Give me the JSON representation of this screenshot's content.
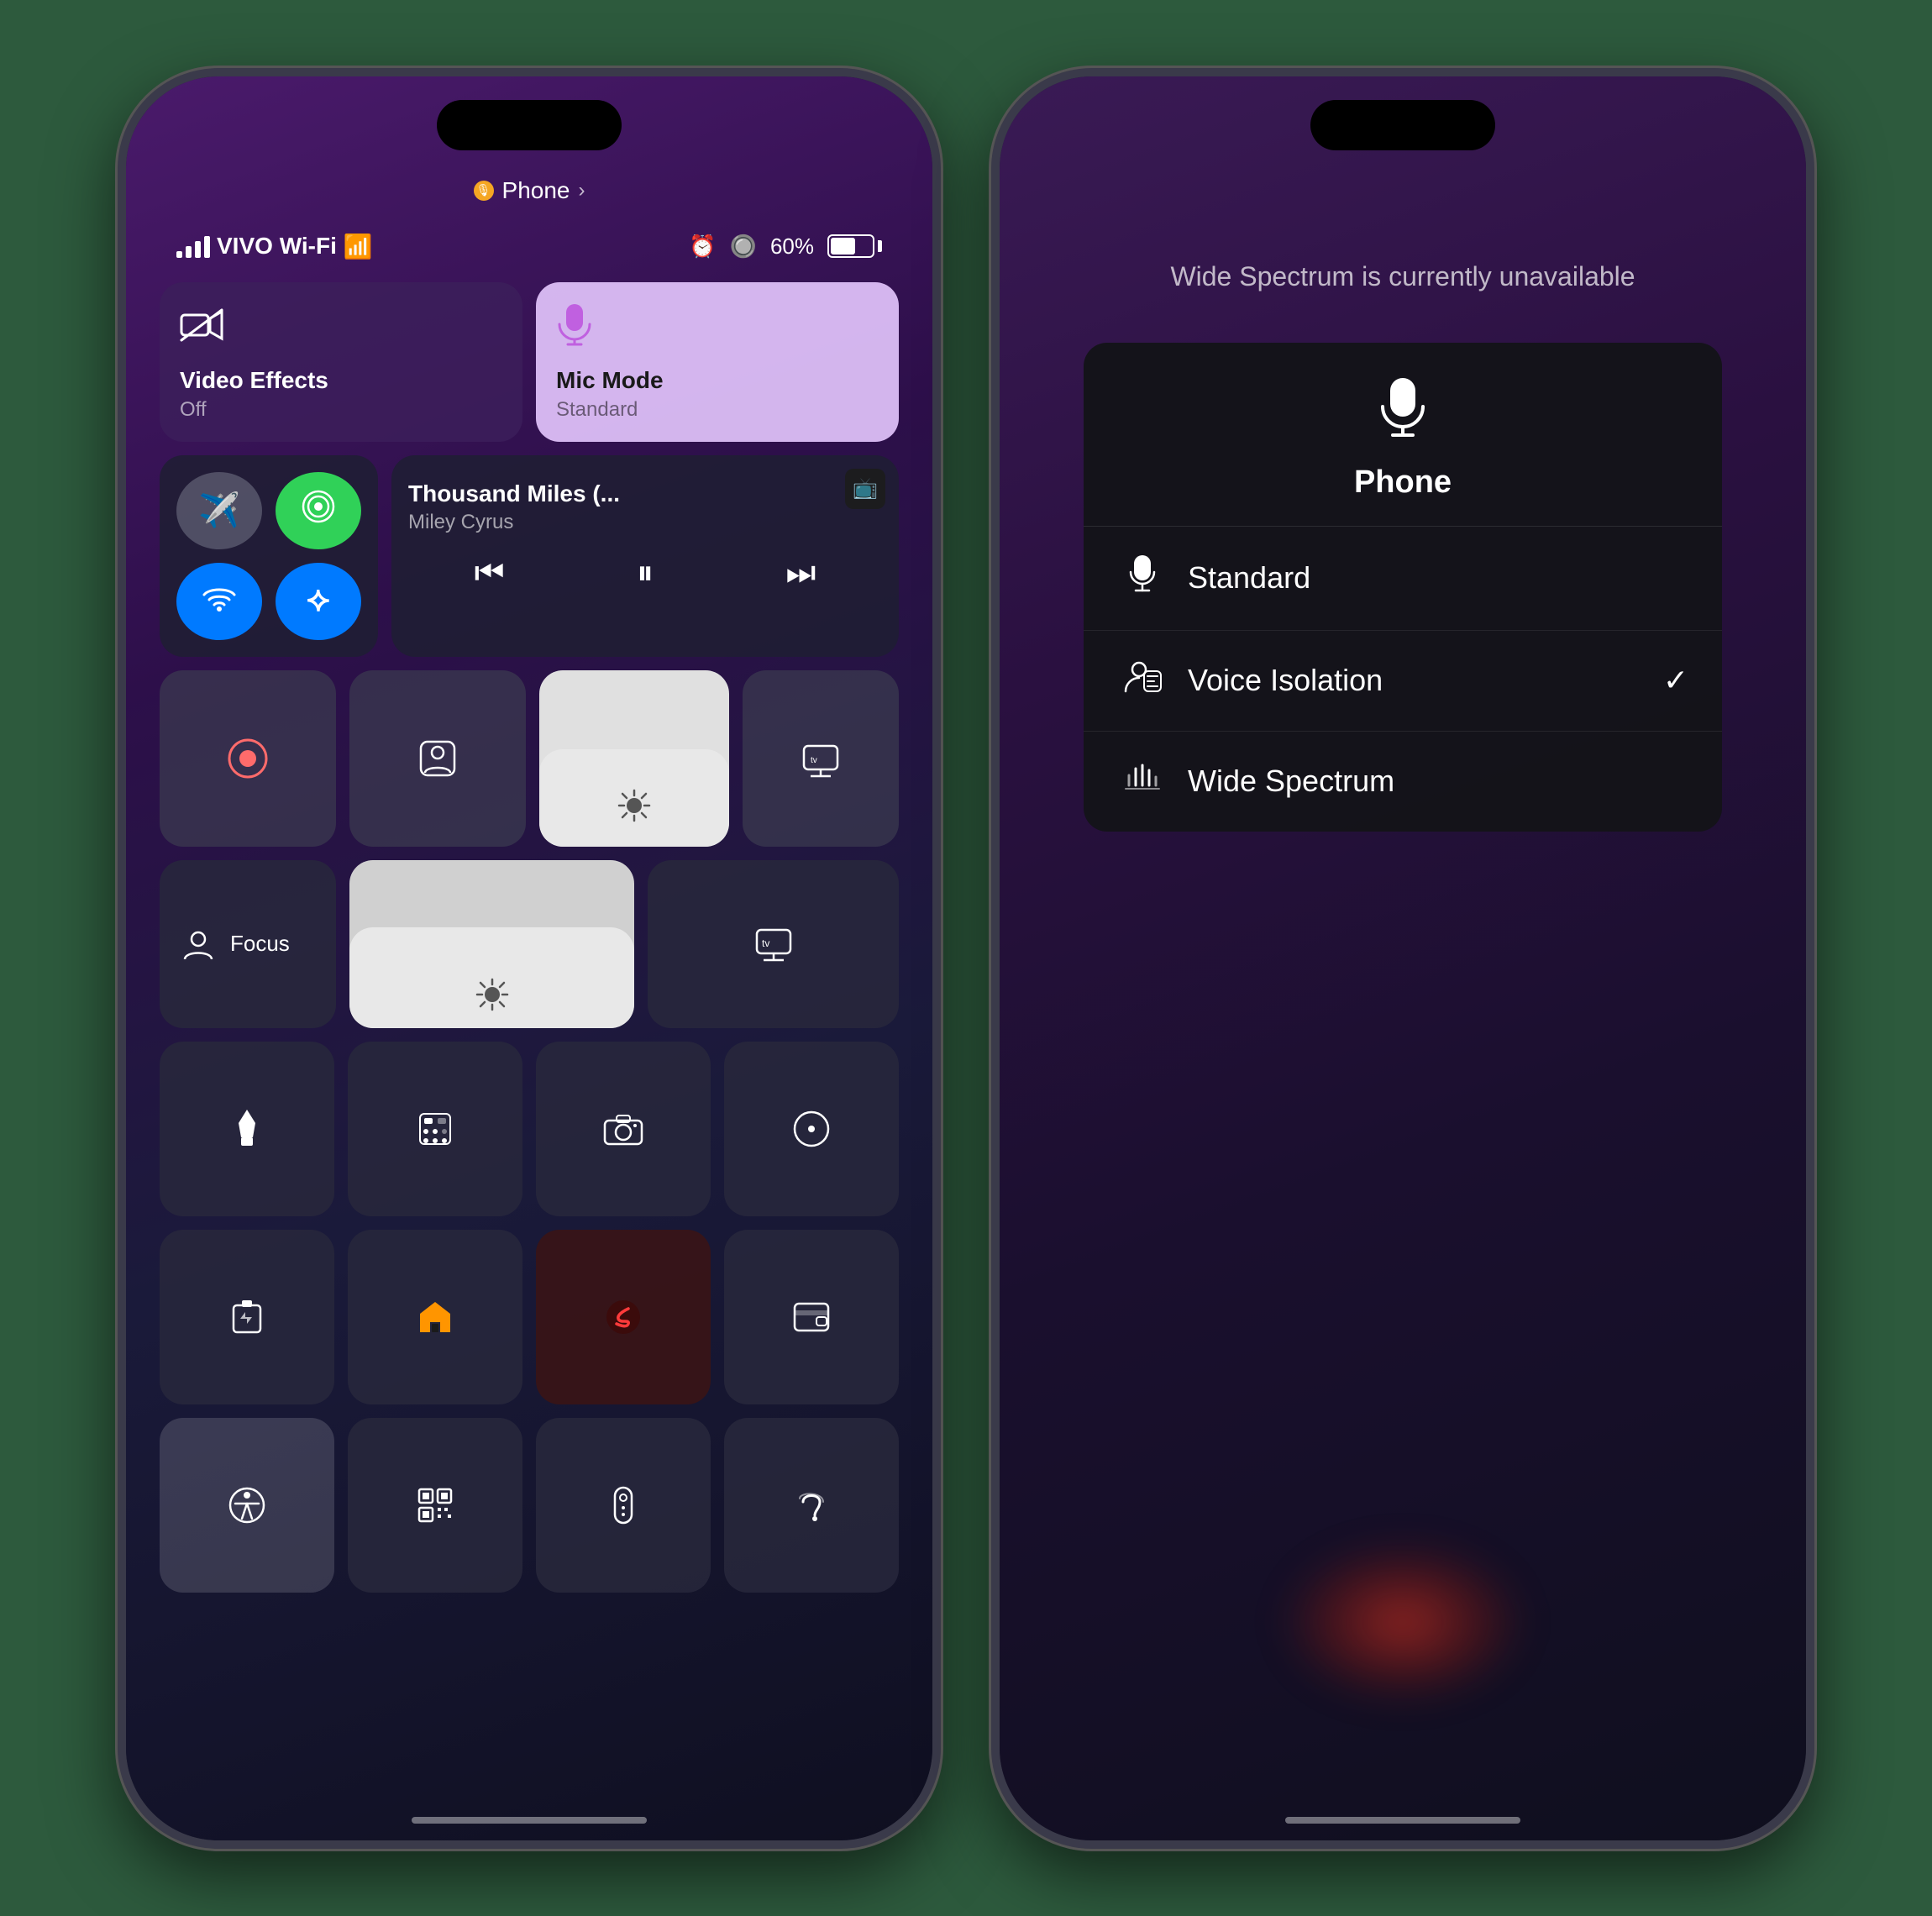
{
  "phone1": {
    "status": {
      "carrier": "VIVO Wi-Fi",
      "battery_pct": "60%",
      "app_indicator": "Phone",
      "chevron": "›"
    },
    "video_effects": {
      "label": "Video Effects",
      "sublabel": "Off",
      "icon": "📵"
    },
    "mic_mode": {
      "label": "Mic Mode",
      "sublabel": "Standard",
      "icon": "🎙️"
    },
    "media": {
      "title": "Thousand Miles (...",
      "artist": "Miley Cyrus",
      "app_icon": "📺"
    },
    "connectivity": {
      "airplane": "✈",
      "cellular": "📡",
      "wifi": "WiFi",
      "bluetooth": "Bt"
    },
    "focus_label": "Focus",
    "bottom_buttons": [
      {
        "icon": "🔦",
        "label": ""
      },
      {
        "icon": "⌨️",
        "label": ""
      },
      {
        "icon": "📷",
        "label": ""
      },
      {
        "icon": "◎",
        "label": ""
      },
      {
        "icon": "🔋",
        "label": ""
      },
      {
        "icon": "🏠",
        "label": ""
      },
      {
        "icon": "S",
        "label": ""
      },
      {
        "icon": "💳",
        "label": ""
      },
      {
        "icon": "⚫",
        "label": ""
      },
      {
        "icon": "⊞",
        "label": ""
      },
      {
        "icon": "📺",
        "label": ""
      },
      {
        "icon": "👂",
        "label": ""
      }
    ]
  },
  "phone2": {
    "unavailable_text": "Wide Spectrum is currently unavailable",
    "panel_title": "Phone",
    "options": [
      {
        "icon": "🎤",
        "label": "Standard",
        "checked": false
      },
      {
        "icon": "👤",
        "label": "Voice Isolation",
        "checked": true
      },
      {
        "icon": "📊",
        "label": "Wide Spectrum",
        "checked": false
      }
    ]
  }
}
